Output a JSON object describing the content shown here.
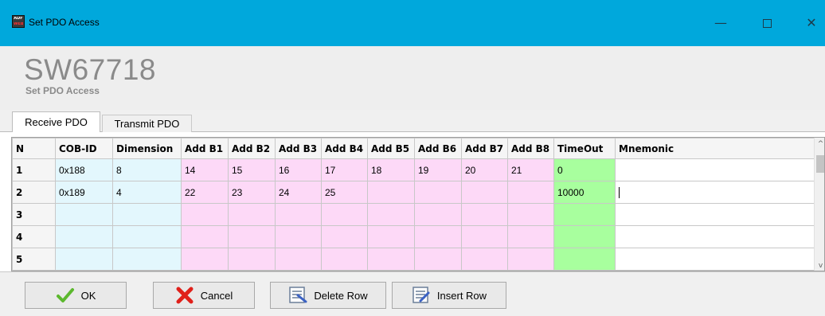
{
  "window": {
    "title": "Set PDO Access",
    "icon_text_top": "ADF",
    "icon_text_bottom": "WEB",
    "controls": {
      "minimize": "—",
      "close": "✕"
    }
  },
  "header": {
    "code": "SW67718",
    "subtitle": "Set PDO Access"
  },
  "tabs": [
    {
      "label": "Receive PDO",
      "active": true
    },
    {
      "label": "Transmit PDO",
      "active": false
    }
  ],
  "grid": {
    "columns": [
      "N",
      "COB-ID",
      "Dimension",
      "Add B1",
      "Add B2",
      "Add B3",
      "Add B4",
      "Add B5",
      "Add B6",
      "Add B7",
      "Add B8",
      "TimeOut",
      "Mnemonic"
    ],
    "rows": [
      [
        "1",
        "0x188",
        "8",
        "14",
        "15",
        "16",
        "17",
        "18",
        "19",
        "20",
        "21",
        "0",
        ""
      ],
      [
        "2",
        "0x189",
        "4",
        "22",
        "23",
        "24",
        "25",
        "",
        "",
        "",
        "",
        "10000",
        ""
      ],
      [
        "3",
        "",
        "",
        "",
        "",
        "",
        "",
        "",
        "",
        "",
        "",
        "",
        ""
      ],
      [
        "4",
        "",
        "",
        "",
        "",
        "",
        "",
        "",
        "",
        "",
        "",
        "",
        ""
      ],
      [
        "5",
        "",
        "",
        "",
        "",
        "",
        "",
        "",
        "",
        "",
        "",
        "",
        ""
      ],
      [
        "",
        "",
        "",
        "",
        "",
        "",
        "",
        "",
        "",
        "",
        "",
        "",
        ""
      ]
    ],
    "colors": {
      "cob_dimension": "#e3f7fd",
      "add_bytes": "#fdd9f7",
      "timeout": "#a8ff9e"
    }
  },
  "scrollbar": {
    "up": "^",
    "down": "v"
  },
  "buttons": {
    "ok": "OK",
    "cancel": "Cancel",
    "delete_row": "Delete Row",
    "insert_row": "Insert Row"
  },
  "icons": {
    "ok": "checkmark-icon",
    "cancel": "red-x-icon",
    "delete_row": "delete-row-icon",
    "insert_row": "insert-row-icon"
  }
}
